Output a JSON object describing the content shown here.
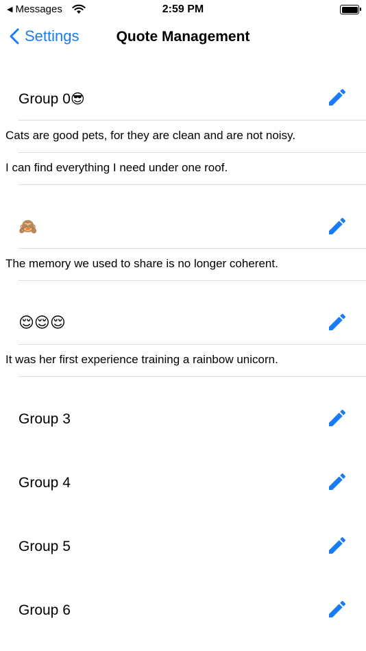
{
  "status_bar": {
    "back_app": "Messages",
    "time": "2:59 PM"
  },
  "nav": {
    "back_label": "Settings",
    "title": "Quote Management"
  },
  "groups": [
    {
      "label": "Group 0",
      "emoji": "😎",
      "quotes": [
        "Cats are good pets, for they are clean and are not noisy.",
        "I can find everything I need under one roof."
      ]
    },
    {
      "label": "",
      "emoji": "🙈",
      "quotes": [
        "The memory we used to share is no longer coherent."
      ]
    },
    {
      "label": "",
      "emoji": "😌😌😌",
      "quotes": [
        "It was her first experience training a rainbow unicorn."
      ]
    },
    {
      "label": "Group 3",
      "emoji": "",
      "quotes": []
    },
    {
      "label": "Group 4",
      "emoji": "",
      "quotes": []
    },
    {
      "label": "Group 5",
      "emoji": "",
      "quotes": []
    },
    {
      "label": "Group 6",
      "emoji": "",
      "quotes": []
    }
  ],
  "icons": {
    "edit": "pencil-icon",
    "back": "chevron-left-icon"
  },
  "colors": {
    "accent": "#1a7cf5",
    "separator": "#dcdcdc"
  }
}
